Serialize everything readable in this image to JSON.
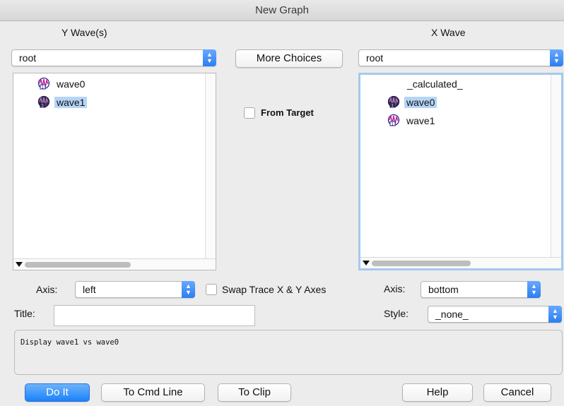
{
  "window": {
    "title": "New Graph"
  },
  "y_panel": {
    "header": "Y Wave(s)",
    "folder": "root",
    "items": [
      {
        "label": "wave0",
        "icon": "wave-icon",
        "selected": false
      },
      {
        "label": "wave1",
        "icon": "wave-icon-selected",
        "selected": true
      }
    ],
    "axis_label": "Axis:",
    "axis_value": "left"
  },
  "middle": {
    "more_choices": "More Choices",
    "from_target": "From Target",
    "swap_axes": "Swap Trace X & Y Axes"
  },
  "x_panel": {
    "header": "X Wave",
    "folder": "root",
    "items": [
      {
        "label": "_calculated_",
        "icon": "",
        "selected": false
      },
      {
        "label": "wave0",
        "icon": "wave-icon-selected",
        "selected": true
      },
      {
        "label": "wave1",
        "icon": "wave-icon",
        "selected": false
      }
    ],
    "axis_label": "Axis:",
    "axis_value": "bottom",
    "style_label": "Style:",
    "style_value": "_none_"
  },
  "title_field": {
    "label": "Title:",
    "value": ""
  },
  "command": "Display wave1 vs wave0",
  "buttons": {
    "do_it": "Do It",
    "to_cmd_line": "To Cmd Line",
    "to_clip": "To Clip",
    "help": "Help",
    "cancel": "Cancel"
  },
  "colors": {
    "accent_blue": "#1a82fb",
    "selection": "#b5d5f7",
    "focus_ring": "#a6c8ef"
  }
}
